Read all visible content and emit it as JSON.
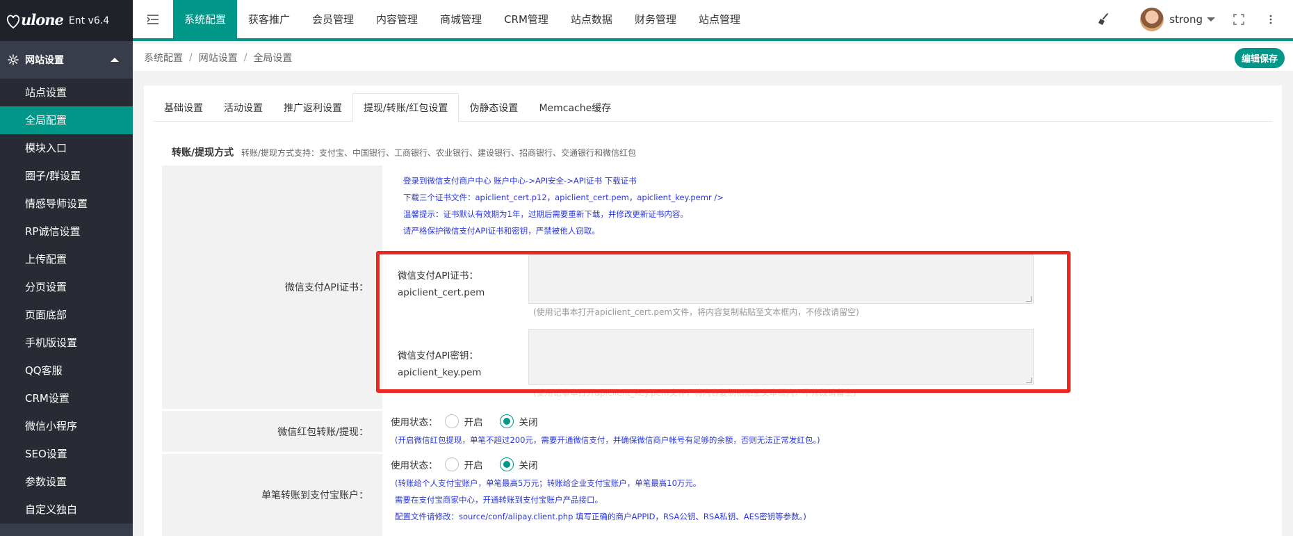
{
  "brand": {
    "logo_text": "ulone",
    "version": "Ent v6.4"
  },
  "sidebar": {
    "group_label": "网站设置",
    "items": [
      {
        "label": "站点设置"
      },
      {
        "label": "全局配置"
      },
      {
        "label": "模块入口"
      },
      {
        "label": "圈子/群设置"
      },
      {
        "label": "情感导师设置"
      },
      {
        "label": "RP诚信设置"
      },
      {
        "label": "上传配置"
      },
      {
        "label": "分页设置"
      },
      {
        "label": "页面底部"
      },
      {
        "label": "手机版设置"
      },
      {
        "label": "QQ客服"
      },
      {
        "label": "CRM设置"
      },
      {
        "label": "微信小程序"
      },
      {
        "label": "SEO设置"
      },
      {
        "label": "参数设置"
      },
      {
        "label": "自定义独白"
      }
    ]
  },
  "topnav": {
    "items": [
      {
        "label": "系统配置"
      },
      {
        "label": "获客推广"
      },
      {
        "label": "会员管理"
      },
      {
        "label": "内容管理"
      },
      {
        "label": "商城管理"
      },
      {
        "label": "CRM管理"
      },
      {
        "label": "站点数据"
      },
      {
        "label": "财务管理"
      },
      {
        "label": "站点管理"
      }
    ],
    "username": "strong"
  },
  "breadcrumb": {
    "items": [
      "系统配置",
      "网站设置",
      "全局设置"
    ],
    "sep": "/"
  },
  "toolbar": {
    "save_label": "编辑保存"
  },
  "tabs": {
    "items": [
      {
        "label": "基础设置"
      },
      {
        "label": "活动设置"
      },
      {
        "label": "推广返利设置"
      },
      {
        "label": "提现/转账/红包设置"
      },
      {
        "label": "伪静态设置"
      },
      {
        "label": "Memcache缓存"
      }
    ]
  },
  "section": {
    "title": "转账/提现方式",
    "subtitle": "转账/提现方式支持：支付宝、中国银行、工商银行、农业银行、建设银行、招商银行、交通银行和微信红包"
  },
  "wechat_cert": {
    "label": "微信支付API证书：",
    "notes": [
      "登录到微信支付商户中心 账户中心->API安全->API证书 下载证书",
      "下载三个证书文件：apiclient_cert.p12，apiclient_cert.pem，apiclient_key.pemr />",
      "温馨提示：证书默认有效期为1年，过期后需要重新下载，并修改更新证书内容。",
      "请严格保护微信支付API证书和密钥，严禁被他人窃取。"
    ],
    "cert_field": {
      "line1": "微信支付API证书：",
      "line2": "apiclient_cert.pem",
      "value": ""
    },
    "cert_hint": "(使用记事本打开apiclient_cert.pem文件，将内容复制粘贴至文本框内，不修改请留空)",
    "key_field": {
      "line1": "微信支付API密钥：",
      "line2": "apiclient_key.pem",
      "value": ""
    },
    "key_hint": "(使用记事本打开apiclient_key.pem文件，将内容复制粘贴至文本框内，不修改请留空)"
  },
  "redpack": {
    "label": "微信红包转账/提现：",
    "status_label": "使用状态：",
    "on_label": "开启",
    "off_label": "关闭",
    "selected": "off",
    "note": "(开启微信红包提现，单笔不超过200元，需要开通微信支付，并确保微信商户帐号有足够的余额，否则无法正常发红包。)"
  },
  "alipay": {
    "label": "单笔转账到支付宝账户：",
    "status_label": "使用状态：",
    "on_label": "开启",
    "off_label": "关闭",
    "selected": "off",
    "notes": [
      "(转账给个人支付宝账户，单笔最高5万元；转账给企业支付宝账户，单笔最高10万元。",
      "需要在支付宝商家中心，开通转账到支付宝账户产品接口。",
      "配置文件请修改：source/conf/alipay.client.php 填写正确的商户APPID，RSA公钥、RSA私钥、AES密钥等参数。)"
    ]
  },
  "colors": {
    "accent": "#009688",
    "sidebar": "#393d49",
    "sidebar_sub": "#282b33",
    "note_blue": "#2b38e0",
    "highlight_red": "#f0261e"
  }
}
